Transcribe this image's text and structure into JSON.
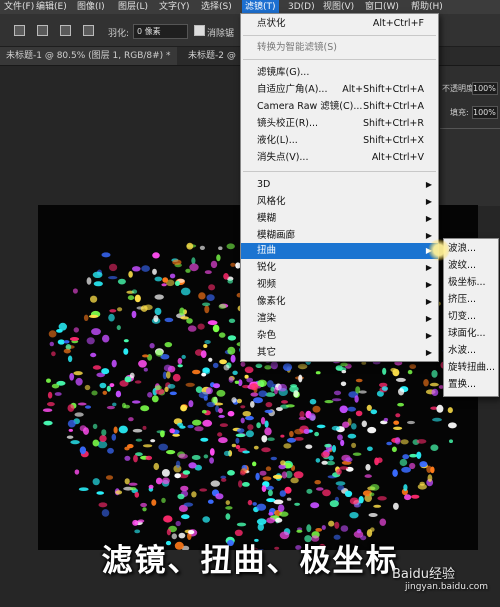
{
  "menubar": {
    "items": [
      "文件(F)",
      "编辑(E)",
      "图像(I)",
      "图层(L)",
      "文字(Y)",
      "选择(S)",
      "滤镜(T)",
      "3D(D)",
      "视图(V)",
      "窗口(W)",
      "帮助(H)"
    ],
    "active_index": 6
  },
  "options": {
    "feather_label": "羽化:",
    "feather_value": "0 像素",
    "antialias_label": "消除锯"
  },
  "tabs": [
    "未标题-1 @ 80.5% (图层 1, RGB/8#) *",
    "未标题-2 @"
  ],
  "right_panel": {
    "opacity_label": "不透明度:",
    "opacity_value": "100%",
    "fill_label": "填充:",
    "fill_value": "100%"
  },
  "filter_menu": {
    "top_items": [
      {
        "label": "点状化",
        "shortcut": "Alt+Ctrl+F"
      },
      {
        "label": "转换为智能滤镜(S)",
        "shortcut": ""
      },
      {
        "label": "滤镜库(G)...",
        "shortcut": ""
      },
      {
        "label": "自适应广角(A)...",
        "shortcut": "Alt+Shift+Ctrl+A"
      },
      {
        "label": "Camera Raw 滤镜(C)...",
        "shortcut": "Shift+Ctrl+A"
      },
      {
        "label": "镜头校正(R)...",
        "shortcut": "Shift+Ctrl+R"
      },
      {
        "label": "液化(L)...",
        "shortcut": "Shift+Ctrl+X"
      },
      {
        "label": "消失点(V)...",
        "shortcut": "Alt+Ctrl+V"
      }
    ],
    "groups": [
      "3D",
      "风格化",
      "模糊",
      "模糊画廊",
      "扭曲",
      "锐化",
      "视频",
      "像素化",
      "渲染",
      "杂色",
      "其它"
    ],
    "highlighted_group": "扭曲"
  },
  "distort_submenu": [
    "波浪...",
    "波纹...",
    "极坐标...",
    "挤压...",
    "切变...",
    "球面化...",
    "水波...",
    "旋转扭曲...",
    "置换..."
  ],
  "caption": "滤镜、扭曲、极坐标",
  "watermark": {
    "brand": "Baidu经验",
    "url": "jingyan.baidu.com"
  },
  "colors": {
    "highlight": "#1b74d1",
    "menu_bg": "#f0f0f0",
    "canvas_bg": "#050505"
  }
}
